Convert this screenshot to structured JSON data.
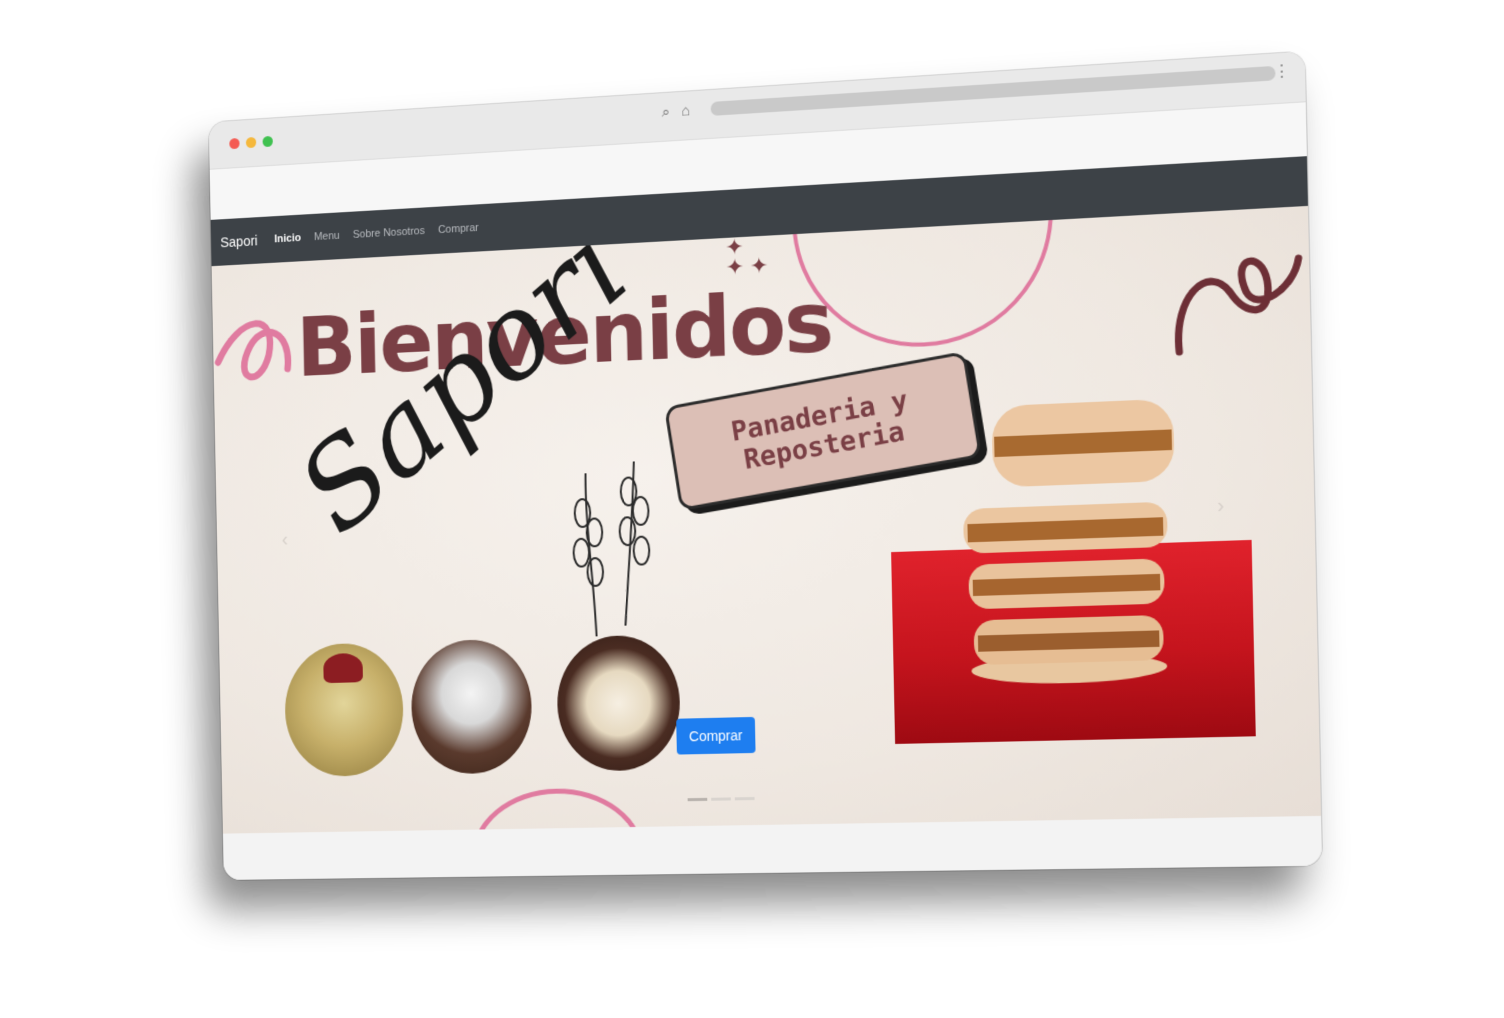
{
  "browser": {
    "url_text": ""
  },
  "navbar": {
    "brand": "Sapori",
    "links": [
      {
        "label": "Inicio",
        "active": true
      },
      {
        "label": "Menu",
        "active": false
      },
      {
        "label": "Sobre Nosotros",
        "active": false
      },
      {
        "label": "Comprar",
        "active": false
      }
    ]
  },
  "hero": {
    "title": "Bienvenidos",
    "script_name": "Sapori",
    "tag": "Panaderia y\nReposteria",
    "button_label": "Comprar",
    "images": [
      "cake-with-bow",
      "chocolate-loaf-cake",
      "decorated-cookies"
    ],
    "main_image": "stacked-alfajores-on-red-plate"
  },
  "colors": {
    "navbar": "#3d4247",
    "title": "#7a3f45",
    "accent_pink": "#e07ba0",
    "button": "#1e7ef0",
    "tag_bg": "#dcbfb6"
  }
}
